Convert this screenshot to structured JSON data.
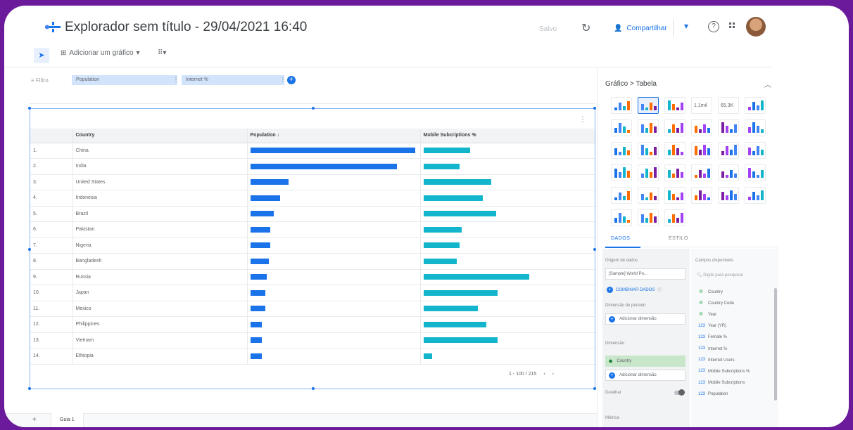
{
  "app": {
    "title": "Explorador sem título - 29/04/2021 16:40",
    "saved_label": "Salvo",
    "share_label": "Compartilhar"
  },
  "toolbar": {
    "add_chart_label": "Adicionar um gráfico",
    "add_control_glyph": "8 8"
  },
  "filter": {
    "label": "Filtro",
    "chips": [
      "Population",
      "Internet %"
    ]
  },
  "table": {
    "headers": {
      "country": "Country",
      "population": "Population ↓",
      "mobile": "Mobile Subcriptions %"
    },
    "rows": [
      {
        "n": "1.",
        "country": "China",
        "population": 1.0,
        "mobile": 0.28
      },
      {
        "n": "2.",
        "country": "India",
        "population": 0.89,
        "mobile": 0.22
      },
      {
        "n": "3.",
        "country": "United States",
        "population": 0.23,
        "mobile": 0.41
      },
      {
        "n": "4.",
        "country": "Indonesia",
        "population": 0.18,
        "mobile": 0.36
      },
      {
        "n": "5.",
        "country": "Brazil",
        "population": 0.14,
        "mobile": 0.44
      },
      {
        "n": "6.",
        "country": "Pakistan",
        "population": 0.12,
        "mobile": 0.23
      },
      {
        "n": "7.",
        "country": "Nigeria",
        "population": 0.12,
        "mobile": 0.22
      },
      {
        "n": "8.",
        "country": "Bangladesh",
        "population": 0.11,
        "mobile": 0.2
      },
      {
        "n": "9.",
        "country": "Russia",
        "population": 0.1,
        "mobile": 0.64
      },
      {
        "n": "10.",
        "country": "Japan",
        "population": 0.09,
        "mobile": 0.45
      },
      {
        "n": "11.",
        "country": "Mexico",
        "population": 0.09,
        "mobile": 0.33
      },
      {
        "n": "12.",
        "country": "Philippines",
        "population": 0.07,
        "mobile": 0.38
      },
      {
        "n": "13.",
        "country": "Vietnam",
        "population": 0.07,
        "mobile": 0.45
      },
      {
        "n": "14.",
        "country": "Ethiopia",
        "population": 0.07,
        "mobile": 0.05
      }
    ],
    "pagination": "1 - 100 / 215"
  },
  "bottom": {
    "page_tab": "Guia 1"
  },
  "panel": {
    "title": "Gráfico > Tabela",
    "tabs": [
      "DADOS",
      "ESTILO"
    ],
    "scorecard_1": "1,1mil",
    "scorecard_2": "65,3K",
    "data_source_label": "Origem de dados",
    "data_source_value": "[Sample] World Po...",
    "blend_label": "COMBINAR DADOS",
    "period_label": "Dimensão de período",
    "add_dimension": "Adicionar dimensão",
    "dimension_label": "Dimensão",
    "dimension_value": "Country",
    "add_dimension_2": "Adicionar dimensão",
    "drill_label": "Detalhar",
    "metric_label": "Métrica",
    "fields_label": "Campos disponíveis",
    "search_placeholder": "Digite para pesquisar",
    "fields": [
      {
        "type": "dim",
        "name": "Country"
      },
      {
        "type": "dim",
        "name": "Country Code"
      },
      {
        "type": "dim",
        "name": "Year"
      },
      {
        "type": "met",
        "name": "Year (YR)"
      },
      {
        "type": "met",
        "name": "Female %"
      },
      {
        "type": "met",
        "name": "Internet %"
      },
      {
        "type": "met",
        "name": "Internet Users"
      },
      {
        "type": "met",
        "name": "Mobile Subcriptions %"
      },
      {
        "type": "met",
        "name": "Mobile Subcriptions"
      },
      {
        "type": "met",
        "name": "Population"
      }
    ]
  },
  "colors": {
    "accent": "#1a73e8",
    "teal": "#12b5cb",
    "frame": "#6a1a9a"
  }
}
